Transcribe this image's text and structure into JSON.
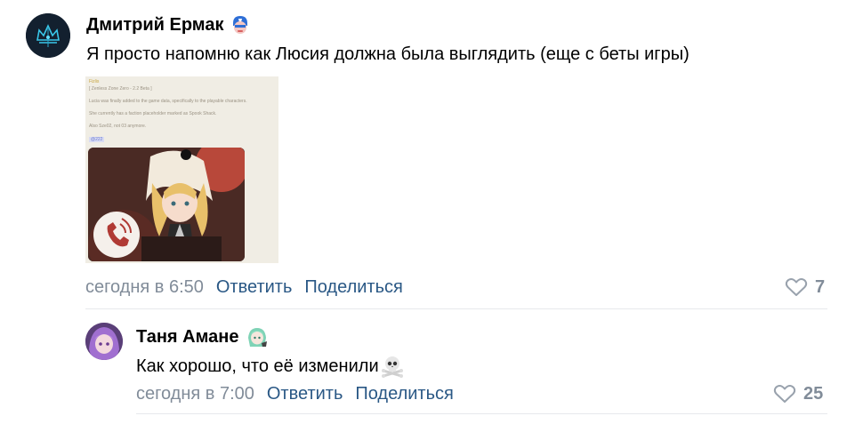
{
  "comments": [
    {
      "author": "Дмитрий Ермак",
      "author_badge_icon": "captain-shield-emoji-icon",
      "text": "Я просто напомню как Люсия должна была выглядить (еще с беты игры)",
      "time": "сегодня в 6:50",
      "reply_label": "Ответить",
      "share_label": "Поделиться",
      "likes": "7",
      "attachment": {
        "lines": [
          "Fizlis",
          "[ Zenless Zone Zero - 2.2 Beta ]",
          "Lucia was finally added to the game data, specifically to the playable characters.",
          "She currently has a faction placeholder marked as Spook Shack.",
          "Also Sze02, not 03 anymore.",
          "@222"
        ]
      }
    },
    {
      "author": "Таня Амане",
      "author_badge_icon": "anime-character-emoji-icon",
      "text": "Как хорошо, что её изменили",
      "text_emoji_icon": "skull-crossbones-emoji-icon",
      "time": "сегодня в 7:00",
      "reply_label": "Ответить",
      "share_label": "Поделиться",
      "likes": "25"
    }
  ],
  "colors": {
    "link": "#2a5885",
    "meta": "#818c99",
    "divider": "#e7e8ec"
  }
}
